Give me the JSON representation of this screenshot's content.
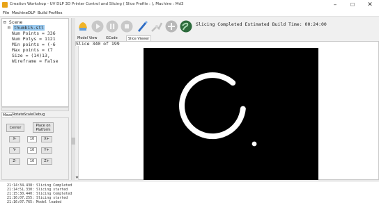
{
  "window": {
    "title": "Creation Workshop - UV DLP 3D Printer Control and Slicing ( Slice Profile : ), Machine : Md3",
    "minimize": "–",
    "maximize": "☐",
    "close": "✕"
  },
  "menu": [
    "File",
    "Machine",
    "DLP",
    "Build Profiles"
  ],
  "tree": {
    "root": "Scene",
    "file": "thumb15.stl",
    "props": [
      "Num Points = 336",
      "Num Polys = 1121",
      "Min points = (-6",
      "Max points = (7",
      "Size = (14)13,",
      "Wireframe = False"
    ]
  },
  "left_tabs": [
    "Move",
    "Rotate",
    "Scale",
    "Debug"
  ],
  "move_panel": {
    "center": "Center",
    "place_on_platform": "Place on Platform",
    "x_minus": "X-",
    "x_value": "10",
    "x_plus": "X+",
    "y_minus": "Y-",
    "y_value": "10",
    "y_plus": "Y+",
    "z_minus": "Z-",
    "z_value": "10",
    "z_plus": "Z+"
  },
  "toolbar_icons": [
    "connect-icon",
    "play-icon",
    "pause-icon",
    "stop-icon",
    "slice-icon",
    "machine-icon",
    "add-icon",
    "globe-icon"
  ],
  "status": "Slicing Completed Estimated Build Time: 00:24:00",
  "view_tabs": [
    "Model View",
    "GCode",
    "Slice Viewer"
  ],
  "slice": {
    "label": "Slice 340 of 199"
  },
  "colors": {
    "slice_background": "#000000",
    "slice_ring": "#ffffff",
    "selection": "#99c9ef"
  },
  "log": [
    "21:14:34.438: Slicing Completed",
    "21:14:51.330: Slicing started",
    "21:15:30.440: Slicing Completed",
    "21:16:07.255: Slicing started",
    "21:16:07.765: Model loaded"
  ]
}
